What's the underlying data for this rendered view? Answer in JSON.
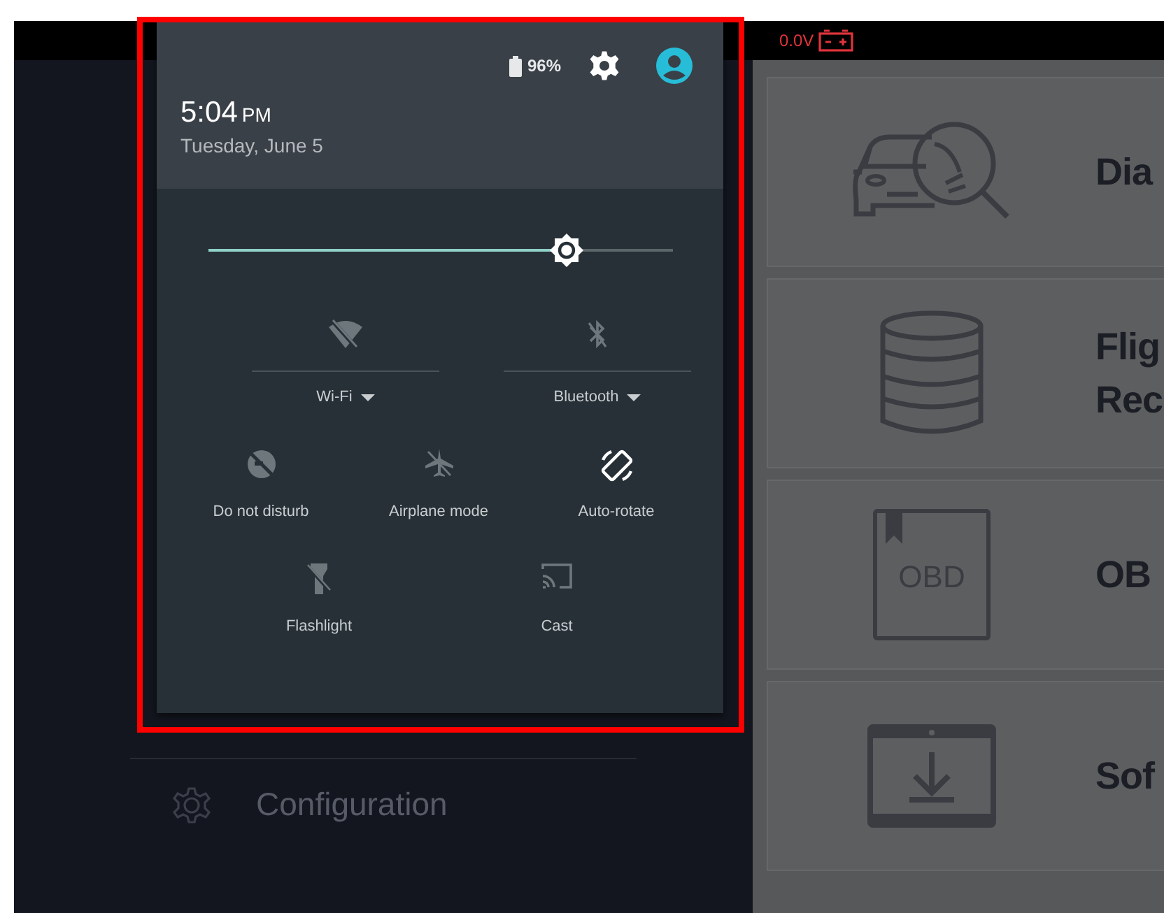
{
  "status_bar": {
    "voltage": "0.0V"
  },
  "drawer": {
    "items": [
      {
        "label": "Configuration"
      }
    ]
  },
  "cards": [
    {
      "title_lines": [
        "Dia"
      ]
    },
    {
      "title_lines": [
        "Flig",
        "Rec"
      ]
    },
    {
      "title_lines": [
        "OB"
      ],
      "icon_text": "OBD"
    },
    {
      "title_lines": [
        "Sof"
      ]
    }
  ],
  "quick_settings": {
    "battery": "96%",
    "time": "5:04",
    "meridiem": "PM",
    "date": "Tuesday, June 5",
    "brightness": {
      "level": 0.77
    },
    "rows": [
      [
        {
          "label": "Wi-Fi",
          "kind": "dropdown",
          "on": false
        },
        {
          "label": "Bluetooth",
          "kind": "dropdown",
          "on": false
        }
      ],
      [
        {
          "label": "Do not disturb",
          "kind": "toggle",
          "on": false
        },
        {
          "label": "Airplane mode",
          "kind": "toggle",
          "on": false
        },
        {
          "label": "Auto-rotate",
          "kind": "toggle",
          "on": true
        }
      ],
      [
        {
          "label": "Flashlight",
          "kind": "toggle",
          "on": false
        },
        {
          "label": "Cast",
          "kind": "toggle",
          "on": false
        }
      ]
    ]
  }
}
